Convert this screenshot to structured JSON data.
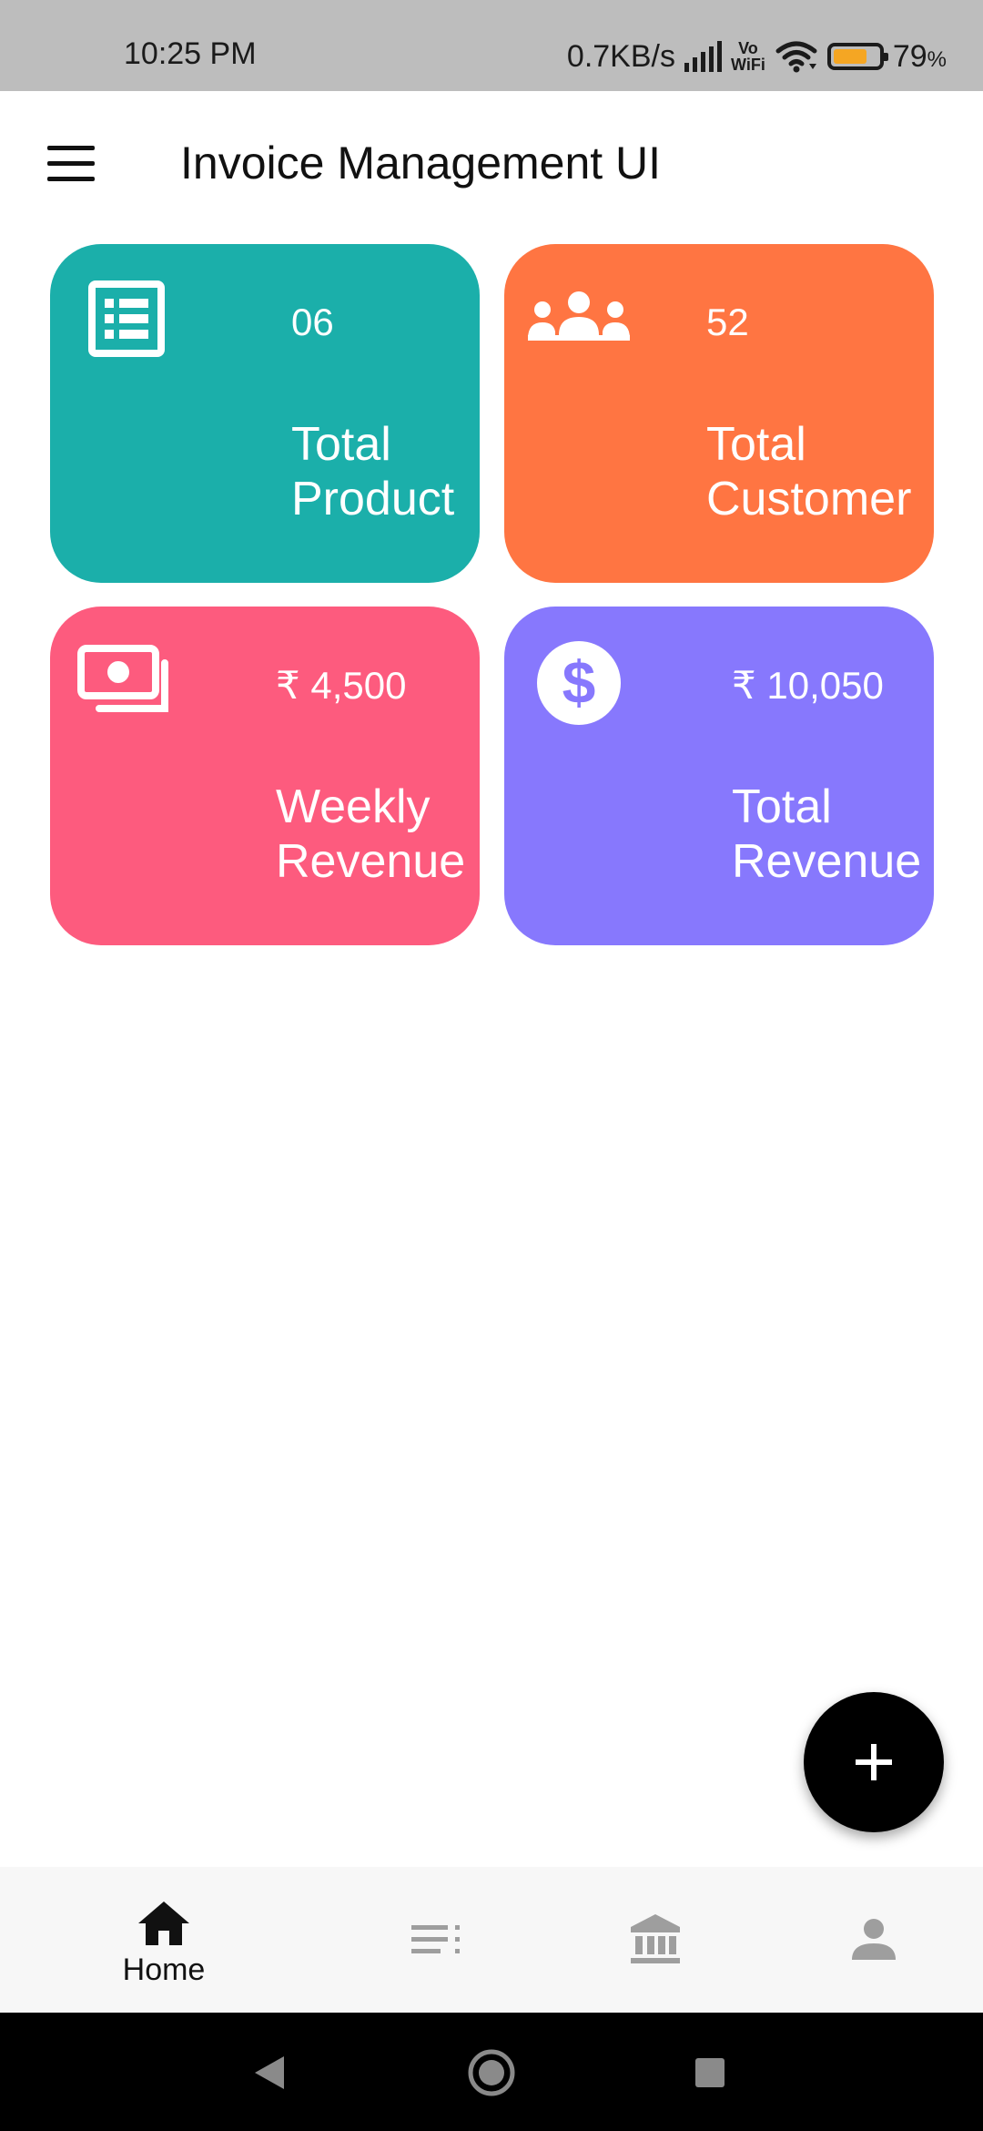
{
  "status_bar": {
    "time": "10:25 PM",
    "network_speed": "0.7KB/s",
    "vowifi_top": "Vo",
    "vowifi_bottom": "WiFi",
    "battery_value": "79",
    "battery_unit": "%",
    "icons": [
      "signal-icon",
      "vowifi-icon",
      "wifi-icon",
      "battery-icon"
    ],
    "battery_level": 0.79
  },
  "app_bar": {
    "title": "Invoice Management UI",
    "menu_icon": "menu-icon"
  },
  "cards": [
    {
      "value": "06",
      "label_line1": "Total",
      "label_line2": "Product",
      "color": "#1bafaa",
      "icon": "list-icon"
    },
    {
      "value": "52",
      "label_line1": "Total",
      "label_line2": "Customer",
      "color": "#ff7542",
      "icon": "group-icon"
    },
    {
      "value": "₹ 4,500",
      "label_line1": "Weekly",
      "label_line2": "Revenue",
      "color": "#fd5b7e",
      "icon": "money-icon"
    },
    {
      "value": "₹ 10,050",
      "label_line1": "Total",
      "label_line2": "Revenue",
      "color": "#8778fd",
      "icon": "dollar-icon"
    }
  ],
  "fab": {
    "icon": "plus-icon"
  },
  "bottom_nav": {
    "items": [
      {
        "label": "Home",
        "icon": "home-icon",
        "active": true
      },
      {
        "icon": "list-icon",
        "active": false
      },
      {
        "icon": "bank-icon",
        "active": false
      },
      {
        "icon": "person-icon",
        "active": false
      }
    ],
    "active_color": "#111111",
    "inactive_color": "#9e9e9e"
  },
  "system_nav": {
    "icons": [
      "back-icon",
      "home-circle-icon",
      "recents-icon"
    ]
  }
}
